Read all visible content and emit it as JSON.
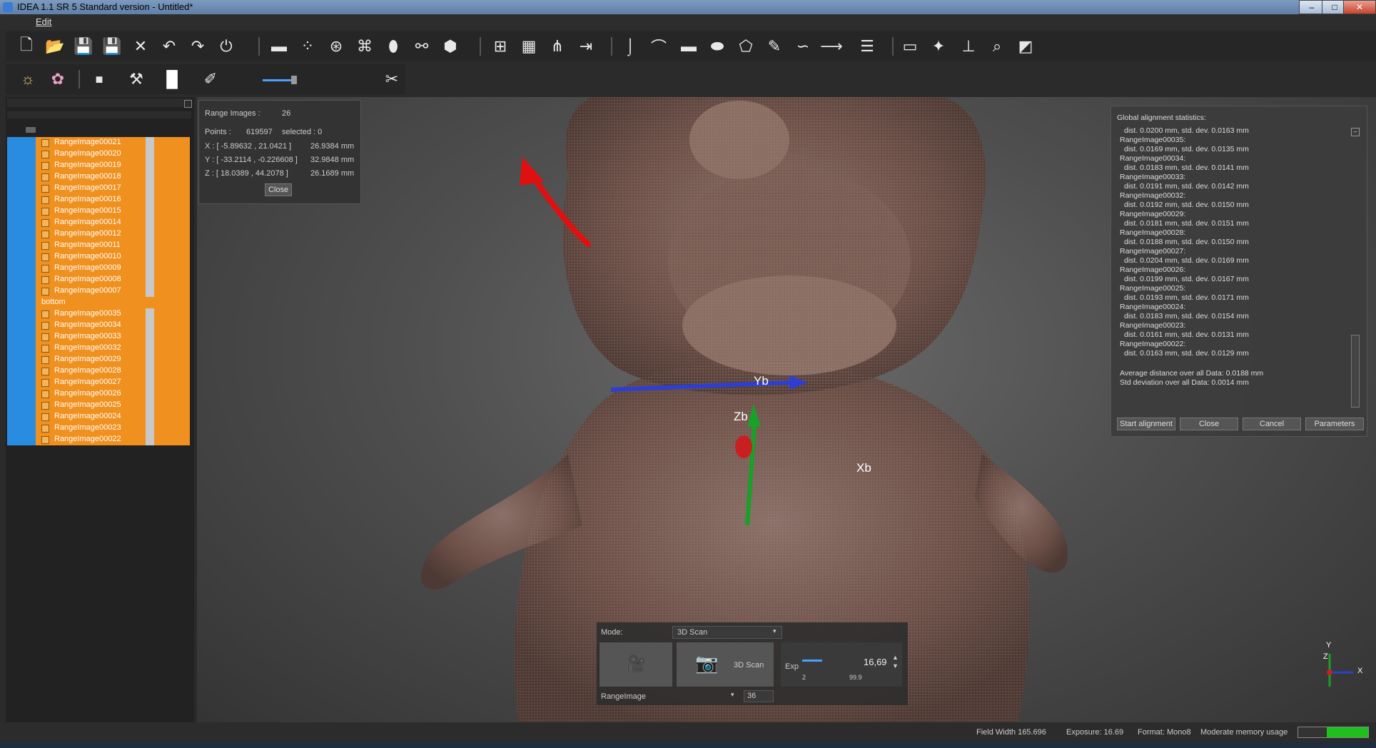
{
  "window": {
    "title": "IDEA 1.1 SR 5 Standard version - Untitled*"
  },
  "menu": {
    "edit": "Edit"
  },
  "toolbar1": {
    "icons": [
      "new-file-icon",
      "open-folder-icon",
      "save-icon",
      "save-as-icon",
      "delete-icon",
      "undo-icon",
      "redo-icon",
      "power-icon",
      "scanner-icon",
      "points-icon",
      "align-icon",
      "mesh-icon",
      "merge-icon",
      "split-icon",
      "hexagon-icon",
      "grid-select-icon",
      "grid-icon",
      "fan-icon",
      "arrows-icon",
      "hook-icon",
      "curve-icon",
      "rectangle-icon",
      "ellipse-icon",
      "lasso-icon",
      "freehand-icon",
      "path-icon",
      "line-icon",
      "layers-icon",
      "window-icon",
      "settings-icon",
      "plane-icon",
      "zoom-icon",
      "cube-icon"
    ]
  },
  "toolbar2": {
    "icons": [
      "light-icon",
      "palette-icon",
      "stop-icon",
      "tools-icon",
      "white-square-icon",
      "brush-icon",
      "slider-icon",
      "wrench-icon"
    ]
  },
  "tree": {
    "items": [
      {
        "label": "RangeImage00021",
        "group": false
      },
      {
        "label": "RangeImage00020",
        "group": false
      },
      {
        "label": "RangeImage00019",
        "group": false
      },
      {
        "label": "RangeImage00018",
        "group": false
      },
      {
        "label": "RangeImage00017",
        "group": false
      },
      {
        "label": "RangeImage00016",
        "group": false
      },
      {
        "label": "RangeImage00015",
        "group": false
      },
      {
        "label": "RangeImage00014",
        "group": false
      },
      {
        "label": "RangeImage00012",
        "group": false
      },
      {
        "label": "RangeImage00011",
        "group": false
      },
      {
        "label": "RangeImage00010",
        "group": false
      },
      {
        "label": "RangeImage00009",
        "group": false
      },
      {
        "label": "RangeImage00008",
        "group": false
      },
      {
        "label": "RangeImage00007",
        "group": false
      },
      {
        "label": "bottom",
        "group": true
      },
      {
        "label": "RangeImage00035",
        "group": false
      },
      {
        "label": "RangeImage00034",
        "group": false
      },
      {
        "label": "RangeImage00033",
        "group": false
      },
      {
        "label": "RangeImage00032",
        "group": false
      },
      {
        "label": "RangeImage00029",
        "group": false
      },
      {
        "label": "RangeImage00028",
        "group": false
      },
      {
        "label": "RangeImage00027",
        "group": false
      },
      {
        "label": "RangeImage00026",
        "group": false
      },
      {
        "label": "RangeImage00025",
        "group": false
      },
      {
        "label": "RangeImage00024",
        "group": false
      },
      {
        "label": "RangeImage00023",
        "group": false
      },
      {
        "label": "RangeImage00022",
        "group": false
      }
    ]
  },
  "info": {
    "range_images_label": "Range Images :",
    "range_images_value": "26",
    "points_label": "Points :",
    "points_value": "619597",
    "selected_text": "selected : 0",
    "x_text": "X :  [ -5.89632 , 21.0421 ]",
    "x_size": "26.9384 mm",
    "y_text": "Y :  [ -33.2114 , -0.226608 ]",
    "y_size": "32.9848 mm",
    "z_text": "Z :  [ 18.0389 , 44.2078 ]",
    "z_size": "26.1689 mm",
    "close": "Close"
  },
  "stats": {
    "title": "Global alignment statistics:",
    "lines": [
      "dist. 0.0200 mm, std. dev. 0.0163 mm",
      "RangeImage00035:",
      "dist. 0.0169 mm, std. dev. 0.0135 mm",
      "RangeImage00034:",
      "dist. 0.0183 mm, std. dev. 0.0141 mm",
      "RangeImage00033:",
      "dist. 0.0191 mm, std. dev. 0.0142 mm",
      "RangeImage00032:",
      "dist. 0.0192 mm, std. dev. 0.0150 mm",
      "RangeImage00029:",
      "dist. 0.0181 mm, std. dev. 0.0151 mm",
      "RangeImage00028:",
      "dist. 0.0188 mm, std. dev. 0.0150 mm",
      "RangeImage00027:",
      "dist. 0.0204 mm, std. dev. 0.0169 mm",
      "RangeImage00026:",
      "dist. 0.0199 mm, std. dev. 0.0167 mm",
      "RangeImage00025:",
      "dist. 0.0193 mm, std. dev. 0.0171 mm",
      "RangeImage00024:",
      "dist. 0.0183 mm, std. dev. 0.0154 mm",
      "RangeImage00023:",
      "dist. 0.0161 mm, std. dev. 0.0131 mm",
      "RangeImage00022:",
      "dist. 0.0163 mm, std. dev. 0.0129 mm"
    ],
    "avg": "Average distance over all Data: 0.0188 mm",
    "std": "Std deviation over all Data: 0.0014 mm",
    "btn_start": "Start alignment",
    "btn_close": "Close",
    "btn_cancel": "Cancel",
    "btn_params": "Parameters"
  },
  "axes": {
    "yb": "Yb",
    "zb": "Zb",
    "xb": "Xb",
    "mini_y": "Y",
    "mini_z": "Z",
    "mini_x": "X"
  },
  "scan": {
    "mode_label": "Mode:",
    "mode_value": "3D Scan",
    "scan_label": "3D Scan",
    "exp_label": "Exp",
    "exp_value": "16,69",
    "exp_min": "2",
    "exp_max": "99.9",
    "range_label": "RangeImage",
    "range_value": "36"
  },
  "status": {
    "field_width": "Field Width 165.696",
    "exposure": "Exposure: 16.69",
    "format": "Format: Mono8",
    "memory": "Moderate memory usage"
  },
  "colors": {
    "orange": "#f0901e",
    "blue": "#2a8ce0",
    "annotation": "#e01010"
  }
}
